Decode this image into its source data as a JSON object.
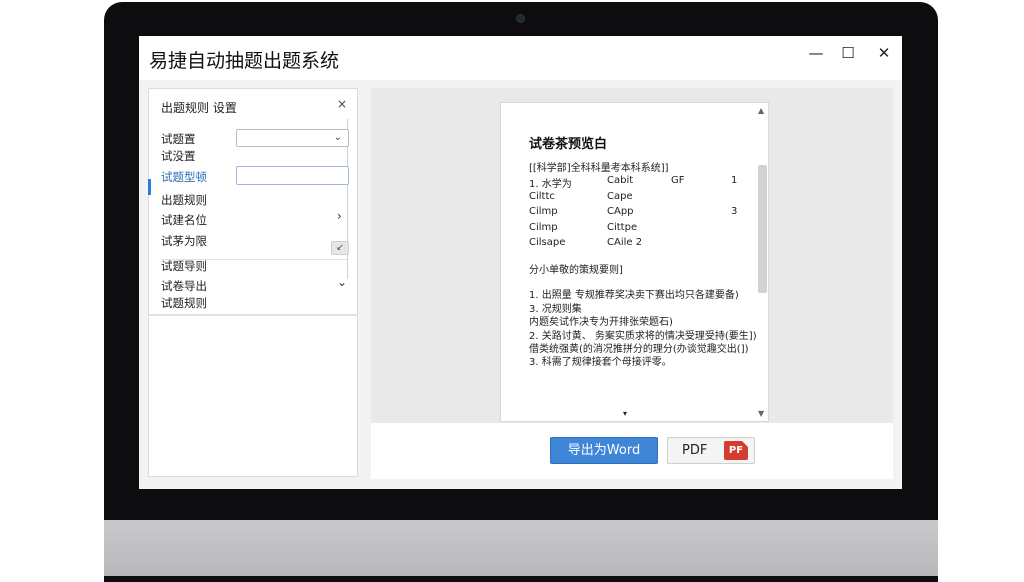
{
  "window": {
    "title": "易捷自动抽题出题系统",
    "min_glyph": "—",
    "max_glyph": "☐",
    "close_glyph": "✕"
  },
  "left_panel": {
    "header": "出题规则 设置",
    "close_glyph": "×",
    "rows": {
      "r1": "试题置",
      "r2": "试没置",
      "r3": "试题型顿",
      "r4": "出题规则",
      "r5": "试建名位",
      "r6": "试茅为限",
      "r7": "试题导则",
      "r8": "试卷导出",
      "r9": "试题规则"
    },
    "dropdown_value": "",
    "textbox_value": "",
    "chevron_right": "›",
    "chevron_down": "⌄",
    "mini_btn": "↙"
  },
  "preview": {
    "title": "试卷茶预览白",
    "subtitle": "[[科学部]全科科量考本科系统]]",
    "q1": {
      "num": "1. 水学为",
      "opts": [
        "Cilttc",
        "Cilmp",
        "Cilmp",
        "Cilsape"
      ],
      "opts2": [
        "Cabit",
        "Cape",
        "CApp",
        "Cittpe",
        "CAile 2"
      ],
      "mark1": "GF",
      "mark2": "1",
      "mark3": "3"
    },
    "section2": "分小单敬的策规要则]",
    "items": [
      "1. 出照量  专规推荐奖决卖下赛出均只各建要备)",
      "3. 况规则集",
      "   内题矣试作决专为开排张荣题石)",
      "2. 关路讨黄、 务案实质求将的情决受理受持(要生])",
      "   借类统强黄(的消况推拼分的理分(办谈觉趣交出(])",
      "3. 科需了规律接套个母接评零。"
    ],
    "scroll_up": "▲",
    "scroll_down": "▼",
    "center_marker": "▾"
  },
  "actions": {
    "word_label": "导出为Word",
    "pdf_label": "PDF",
    "pdf_icon_text": "PF"
  }
}
